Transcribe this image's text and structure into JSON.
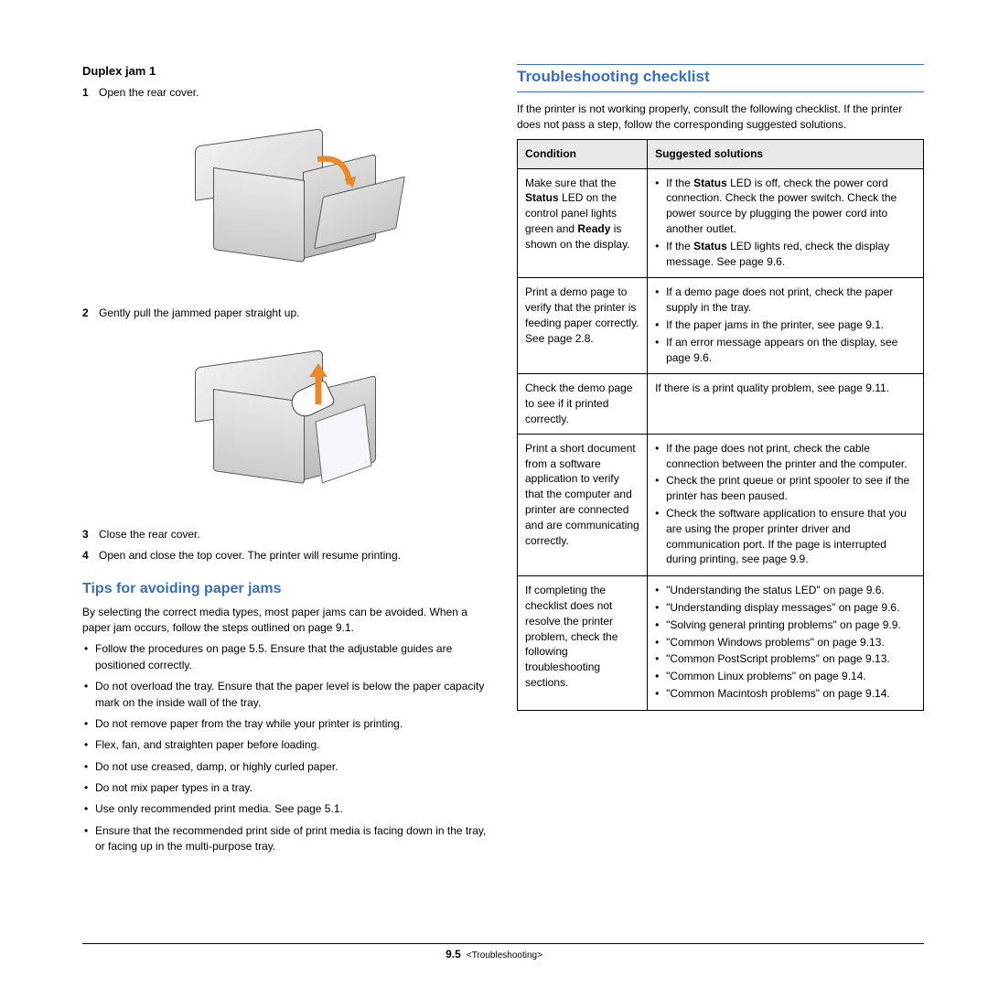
{
  "left": {
    "h1": "Duplex jam 1",
    "steps1": [
      {
        "n": "1",
        "t": "Open the rear cover."
      }
    ],
    "steps2": [
      {
        "n": "2",
        "t": "Gently pull the jammed paper straight up."
      }
    ],
    "steps3": [
      {
        "n": "3",
        "t": "Close the rear cover."
      },
      {
        "n": "4",
        "t": "Open and close the top cover. The printer will resume printing."
      }
    ],
    "tips_title": "Tips for avoiding paper jams",
    "tips_intro": "By selecting the correct media types, most paper jams can be avoided. When a paper jam occurs, follow the steps outlined on page 9.1.",
    "tips": [
      "Follow the procedures on page 5.5. Ensure that the adjustable guides are positioned correctly.",
      "Do not overload the tray. Ensure that the paper level is below the paper capacity mark on the inside wall of the tray.",
      "Do not remove paper from the tray while your printer is printing.",
      "Flex, fan, and straighten paper before loading.",
      "Do not use creased, damp, or highly curled paper.",
      "Do not mix paper types in a tray.",
      "Use only recommended print media. See page 5.1.",
      "Ensure that the recommended print side of print media is facing down in the tray, or facing up in the multi-purpose tray."
    ]
  },
  "right": {
    "title": "Troubleshooting checklist",
    "intro": "If the printer is not working properly, consult the following checklist. If the printer does not pass a step, follow the corresponding suggested solutions.",
    "th1": "Condition",
    "th2": "Suggested solutions",
    "rows": [
      {
        "cond_parts": [
          "Make sure that the ",
          "Status",
          " LED on the control panel lights green and ",
          "Ready",
          " is shown on the display."
        ],
        "sol": [
          {
            "parts": [
              "If the ",
              "Status",
              " LED is off, check the power cord connection. Check the power switch. Check the power source by plugging the power cord into another outlet."
            ]
          },
          {
            "parts": [
              "If the ",
              "Status",
              " LED lights red, check the display message. See page 9.6."
            ]
          }
        ]
      },
      {
        "cond": "Print a demo page to verify that the printer is feeding paper correctly. See page 2.8.",
        "sol": [
          {
            "t": "If a demo page does not print, check the paper supply in the tray."
          },
          {
            "t": "If the paper jams in the printer, see page 9.1."
          },
          {
            "t": "If an error message appears on the display, see page 9.6."
          }
        ]
      },
      {
        "cond": "Check the demo page to see if it printed correctly.",
        "sol_plain": "If there is a print quality problem, see page 9.11."
      },
      {
        "cond": "Print a short document from a software application to verify that the computer and printer are connected and are communicating correctly.",
        "sol": [
          {
            "t": "If the page does not print, check the cable connection between the printer and the computer."
          },
          {
            "t": "Check the print queue or print spooler to see if the printer has been paused."
          },
          {
            "t": "Check the software application to ensure that you are using the proper printer driver and communication port. If the page is interrupted during printing, see page 9.9."
          }
        ]
      },
      {
        "cond": "If completing the checklist does not resolve the printer problem, check the following troubleshooting sections.",
        "sol": [
          {
            "t": "\"Understanding the status LED\" on page 9.6."
          },
          {
            "t": "\"Understanding display messages\" on page 9.6."
          },
          {
            "t": "\"Solving general printing problems\" on page 9.9."
          },
          {
            "t": "\"Common Windows problems\" on page 9.13."
          },
          {
            "t": "\"Common PostScript problems\" on page 9.13."
          },
          {
            "t": "\"Common Linux problems\" on page 9.14."
          },
          {
            "t": "\"Common Macintosh problems\" on page 9.14."
          }
        ]
      }
    ]
  },
  "footer": {
    "page": "9.5",
    "chapter": "<Troubleshooting>"
  }
}
